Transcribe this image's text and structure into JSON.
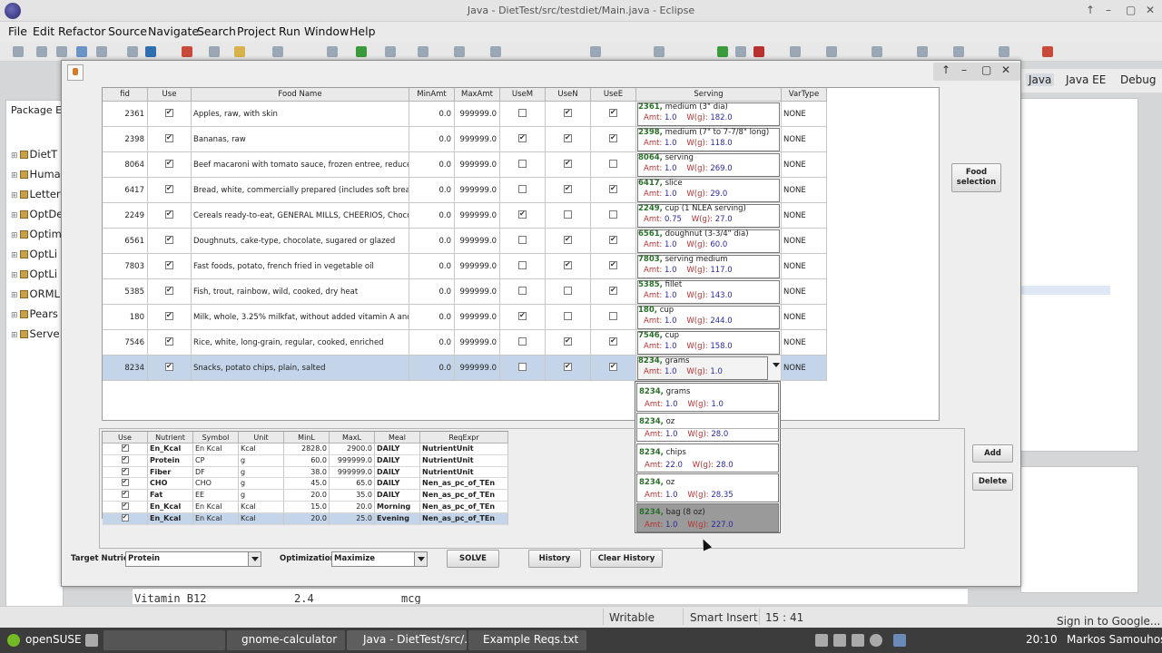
{
  "window_title": "Java - DietTest/src/testdiet/Main.java - Eclipse",
  "menu": [
    "File",
    "Edit",
    "Refactor",
    "Source",
    "Navigate",
    "Search",
    "Project",
    "Run",
    "Window",
    "Help"
  ],
  "perspectives": {
    "java": "Java",
    "java_ee": "Java EE",
    "debug": "Debug"
  },
  "package_explorer": {
    "title": "Package E",
    "items": [
      "DietT",
      "Huma",
      "Letter",
      "OptDe",
      "Optim",
      "OptLi",
      "OptLi",
      "ORML",
      "Pears",
      "Serve"
    ]
  },
  "dialog": {
    "food_table": {
      "headers": [
        "fid",
        "Use",
        "Food Name",
        "MinAmt",
        "MaxAmt",
        "UseM",
        "UseN",
        "UseE",
        "Serving",
        "VarType"
      ],
      "rows": [
        {
          "fid": "2361",
          "use": true,
          "name": "Apples, raw, with skin",
          "min": "0.0",
          "max": "999999.0",
          "usem": false,
          "usen": true,
          "usee": true,
          "s_fid": "2361,",
          "s_desc": "medium (3\" dia)",
          "s_amt": "1.0",
          "s_w": "182.0",
          "vartype": "NONE"
        },
        {
          "fid": "2398",
          "use": true,
          "name": "Bananas, raw",
          "min": "0.0",
          "max": "999999.0",
          "usem": true,
          "usen": true,
          "usee": true,
          "s_fid": "2398,",
          "s_desc": "medium (7\" to 7-7/8\" long)",
          "s_amt": "1.0",
          "s_w": "118.0",
          "vartype": "NONE"
        },
        {
          "fid": "8064",
          "use": true,
          "name": "Beef macaroni with tomato sauce, frozen entree, reduced fat",
          "min": "0.0",
          "max": "999999.0",
          "usem": false,
          "usen": true,
          "usee": false,
          "s_fid": "8064,",
          "s_desc": "serving",
          "s_amt": "1.0",
          "s_w": "269.0",
          "vartype": "NONE"
        },
        {
          "fid": "6417",
          "use": true,
          "name": "Bread, white, commercially prepared (includes soft bread crumbs)",
          "min": "0.0",
          "max": "999999.0",
          "usem": false,
          "usen": true,
          "usee": true,
          "s_fid": "6417,",
          "s_desc": "slice",
          "s_amt": "1.0",
          "s_w": "29.0",
          "vartype": "NONE"
        },
        {
          "fid": "2249",
          "use": true,
          "name": "Cereals ready-to-eat, GENERAL MILLS, CHEERIOS, Chocolate",
          "min": "0.0",
          "max": "999999.0",
          "usem": true,
          "usen": false,
          "usee": false,
          "s_fid": "2249,",
          "s_desc": "cup (1 NLEA serving)",
          "s_amt": "0.75",
          "s_w": "27.0",
          "vartype": "NONE"
        },
        {
          "fid": "6561",
          "use": true,
          "name": "Doughnuts, cake-type, chocolate, sugared or glazed",
          "min": "0.0",
          "max": "999999.0",
          "usem": false,
          "usen": true,
          "usee": true,
          "s_fid": "6561,",
          "s_desc": "doughnut (3-3/4\" dia)",
          "s_amt": "1.0",
          "s_w": "60.0",
          "vartype": "NONE"
        },
        {
          "fid": "7803",
          "use": true,
          "name": "Fast foods, potato, french fried in vegetable oil",
          "min": "0.0",
          "max": "999999.0",
          "usem": false,
          "usen": true,
          "usee": true,
          "s_fid": "7803,",
          "s_desc": "serving medium",
          "s_amt": "1.0",
          "s_w": "117.0",
          "vartype": "NONE"
        },
        {
          "fid": "5385",
          "use": true,
          "name": "Fish, trout, rainbow, wild, cooked, dry heat",
          "min": "0.0",
          "max": "999999.0",
          "usem": false,
          "usen": false,
          "usee": true,
          "s_fid": "5385,",
          "s_desc": "fillet",
          "s_amt": "1.0",
          "s_w": "143.0",
          "vartype": "NONE"
        },
        {
          "fid": "180",
          "use": true,
          "name": "Milk, whole, 3.25% milkfat, without added vitamin A and vitamin D",
          "min": "0.0",
          "max": "999999.0",
          "usem": true,
          "usen": false,
          "usee": false,
          "s_fid": "180,",
          "s_desc": "cup",
          "s_amt": "1.0",
          "s_w": "244.0",
          "vartype": "NONE"
        },
        {
          "fid": "7546",
          "use": true,
          "name": "Rice, white, long-grain, regular, cooked, enriched",
          "min": "0.0",
          "max": "999999.0",
          "usem": false,
          "usen": true,
          "usee": true,
          "s_fid": "7546,",
          "s_desc": "cup",
          "s_amt": "1.0",
          "s_w": "158.0",
          "vartype": "NONE"
        },
        {
          "fid": "8234",
          "use": true,
          "name": "Snacks, potato chips, plain, salted",
          "min": "0.0",
          "max": "999999.0",
          "usem": false,
          "usen": true,
          "usee": true,
          "s_fid": "8234,",
          "s_desc": "grams",
          "s_amt": "1.0",
          "s_w": "1.0",
          "vartype": "NONE"
        }
      ],
      "amt_label": "Amt:",
      "w_label": "W(g):"
    },
    "serving_popup": [
      {
        "fid": "8234,",
        "desc": "grams",
        "amt": "1.0",
        "w": "1.0"
      },
      {
        "fid": "8234,",
        "desc": "oz",
        "amt": "1.0",
        "w": "28.0"
      },
      {
        "fid": "8234,",
        "desc": "chips",
        "amt": "22.0",
        "w": "28.0"
      },
      {
        "fid": "8234,",
        "desc": "oz",
        "amt": "1.0",
        "w": "28.35"
      },
      {
        "fid": "8234,",
        "desc": "bag (8 oz)",
        "amt": "1.0",
        "w": "227.0"
      }
    ],
    "food_selection_label": "Food selection",
    "food_selection_l1": "Food",
    "food_selection_l2": "selection",
    "add_label": "Add",
    "delete_label": "Delete",
    "nutrient_table": {
      "headers": [
        "Use",
        "Nutrient",
        "Symbol",
        "Unit",
        "MinL",
        "MaxL",
        "Meal",
        "ReqExpr"
      ],
      "rows": [
        {
          "use": true,
          "nutrient": "En_Kcal",
          "symbol": "En Kcal",
          "unit": "Kcal",
          "minl": "2828.0",
          "maxl": "2900.0",
          "meal": "DAILY",
          "expr": "NutrientUnit"
        },
        {
          "use": true,
          "nutrient": "Protein",
          "symbol": "CP",
          "unit": "g",
          "minl": "60.0",
          "maxl": "999999.0",
          "meal": "DAILY",
          "expr": "NutrientUnit"
        },
        {
          "use": true,
          "nutrient": "Fiber",
          "symbol": "DF",
          "unit": "g",
          "minl": "38.0",
          "maxl": "999999.0",
          "meal": "DAILY",
          "expr": "NutrientUnit"
        },
        {
          "use": true,
          "nutrient": "CHO",
          "symbol": "CHO",
          "unit": "g",
          "minl": "45.0",
          "maxl": "65.0",
          "meal": "DAILY",
          "expr": "Nen_as_pc_of_TEn"
        },
        {
          "use": true,
          "nutrient": "Fat",
          "symbol": "EE",
          "unit": "g",
          "minl": "20.0",
          "maxl": "35.0",
          "meal": "DAILY",
          "expr": "Nen_as_pc_of_TEn"
        },
        {
          "use": true,
          "nutrient": "En_Kcal",
          "symbol": "En Kcal",
          "unit": "Kcal",
          "minl": "15.0",
          "maxl": "20.0",
          "meal": "Morning",
          "expr": "Nen_as_pc_of_TEn"
        },
        {
          "use": true,
          "nutrient": "En_Kcal",
          "symbol": "En Kcal",
          "unit": "Kcal",
          "minl": "20.0",
          "maxl": "25.0",
          "meal": "Evening",
          "expr": "Nen_as_pc_of_TEn"
        }
      ]
    },
    "target_nutrient_label": "Target Nutrient:",
    "target_nutrient_value": "Protein",
    "optimization_label": "Optimization",
    "optimization_value": "Maximize",
    "solve_label": "SOLVE",
    "history_label": "History",
    "clear_history_label": "Clear History"
  },
  "editor_peek": {
    "line": "Vitamin B12",
    "val": "2.4",
    "mode": "mcg"
  },
  "status": {
    "writable": "Writable",
    "insert": "Smart Insert",
    "position": "15 : 41"
  },
  "taskbar": {
    "start": "openSUSE",
    "items": [
      "gnome-calculator",
      "Java - DietTest/src/...",
      "Example Reqs.txt"
    ],
    "clock": "20:10",
    "user": "Markos Samouhos",
    "sign_in": "Sign in to Google..."
  },
  "colors": {
    "selection": "#c4d5ea",
    "fid_green": "#2a6f2a",
    "label_red": "#b83030",
    "value_blue": "#2a2aa0"
  }
}
